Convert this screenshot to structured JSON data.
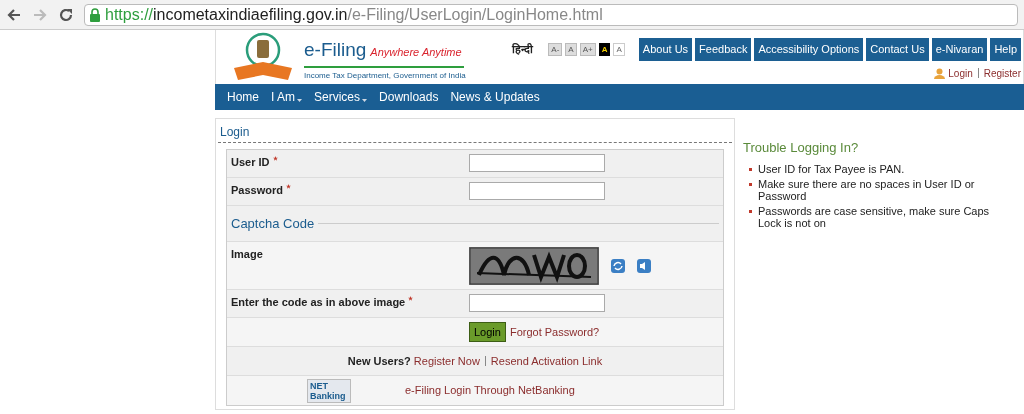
{
  "browser": {
    "url_scheme": "https://",
    "url_host": "incometaxindiaefiling.gov.in",
    "url_path": "/e-Filing/UserLogin/LoginHome.html",
    "forward_disabled": true
  },
  "header": {
    "brand": "e-Filing",
    "tagline": "Anywhere Anytime",
    "department": "Income Tax Department, Government of India",
    "language": "हिन्दी",
    "text_sizes": [
      {
        "label": "A-",
        "kind": "normal"
      },
      {
        "label": "A",
        "kind": "normal"
      },
      {
        "label": "A+",
        "kind": "normal"
      },
      {
        "label": "A",
        "kind": "contrast"
      },
      {
        "label": "A",
        "kind": "plain"
      }
    ],
    "top_links": [
      "About Us",
      "Feedback",
      "Accessibility Options",
      "Contact Us",
      "e-Nivaran",
      "Help"
    ],
    "account_links": [
      "Login",
      "Register"
    ]
  },
  "nav": [
    {
      "label": "Home",
      "has_menu": false
    },
    {
      "label": "I Am",
      "has_menu": true
    },
    {
      "label": "Services",
      "has_menu": true
    },
    {
      "label": "Downloads",
      "has_menu": false
    },
    {
      "label": "News & Updates",
      "has_menu": false
    }
  ],
  "login": {
    "title": "Login",
    "fields": [
      {
        "label": "User ID",
        "required": true
      },
      {
        "label": "Password",
        "required": true
      }
    ],
    "captcha_title": "Captcha Code",
    "image_label": "Image",
    "code_field": {
      "label": "Enter the code as in above image",
      "required": true
    },
    "login_button": "Login",
    "forgot_link": "Forgot Password?",
    "new_users": "New Users?",
    "register_link": "Register Now",
    "resend_link": "Resend Activation Link",
    "netbanking_badge": [
      "NET",
      "Banking"
    ],
    "netbanking_link": "e-Filing Login Through NetBanking"
  },
  "help": {
    "title": "Trouble Logging In?",
    "tips": [
      "User ID for Tax Payee is PAN.",
      "Make sure there are no spaces in User ID or Password",
      "Passwords are case sensitive, make sure Caps Lock is not on"
    ]
  }
}
